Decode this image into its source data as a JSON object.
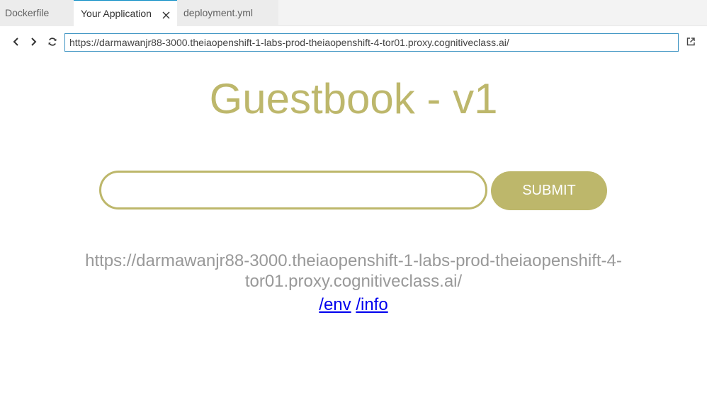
{
  "tabs": [
    {
      "label": "Dockerfile",
      "active": false
    },
    {
      "label": "Your Application",
      "active": true
    },
    {
      "label": "deployment.yml",
      "active": false
    }
  ],
  "toolbar": {
    "url": "https://darmawanjr88-3000.theiaopenshift-1-labs-prod-theiaopenshift-4-tor01.proxy.cognitiveclass.ai/",
    "icons": [
      "chevron-left-icon",
      "chevron-right-icon",
      "refresh-icon",
      "open-external-icon"
    ]
  },
  "page": {
    "title": "Guestbook - v1",
    "entry_value": "",
    "submit_label": "SUBMIT",
    "hostname": "https://darmawanjr88-3000.theiaopenshift-1-labs-prod-theiaopenshift-4-tor01.proxy.cognitiveclass.ai/",
    "links": {
      "env": "/env",
      "info": "/info"
    }
  },
  "colors": {
    "accent": "#bdb76b",
    "muted_text": "#999999",
    "link": "#0000ee",
    "url_border": "#3c93c2"
  }
}
